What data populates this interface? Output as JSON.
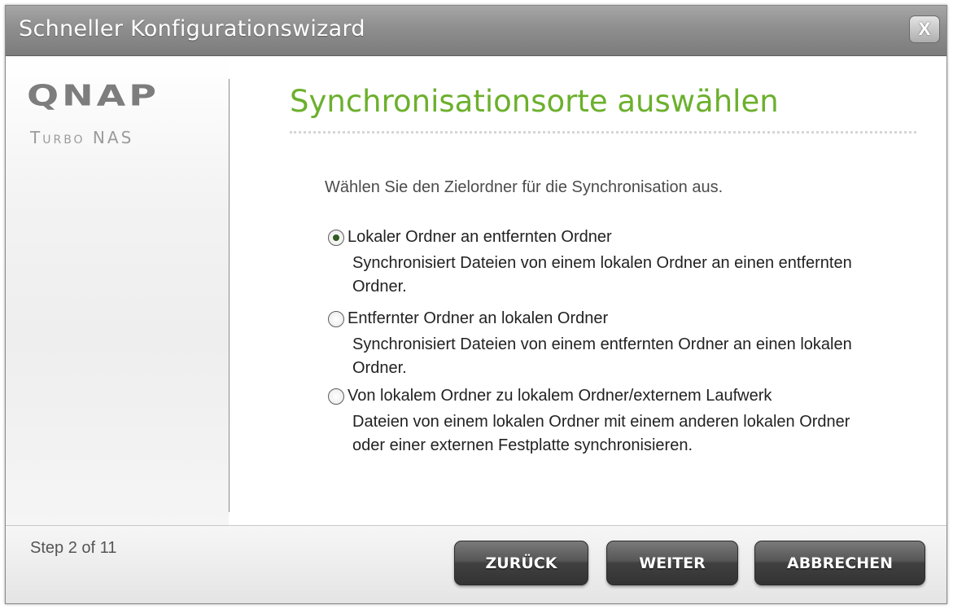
{
  "window": {
    "title": "Schneller Konfigurationswizard",
    "close_label": "X"
  },
  "brand": {
    "logo": "QNAP",
    "sub": "Turbo NAS"
  },
  "main": {
    "heading": "Synchronisationsorte auswählen",
    "intro": "Wählen Sie den Zielordner für die Synchronisation aus.",
    "options": [
      {
        "label": "Lokaler Ordner an entfernten Ordner",
        "description": "Synchronisiert Dateien von einem lokalen Ordner an einen entfernten Ordner.",
        "selected": true
      },
      {
        "label": "Entfernter Ordner an lokalen Ordner",
        "description": "Synchronisiert Dateien von einem entfernten Ordner an einen lokalen Ordner.",
        "selected": false
      },
      {
        "label": "Von lokalem Ordner zu lokalem Ordner/externem Laufwerk",
        "description": "Dateien von einem lokalen Ordner mit einem anderen lokalen Ordner oder einer externen Festplatte synchronisieren.",
        "selected": false
      }
    ]
  },
  "footer": {
    "step": "Step 2 of 11",
    "back_label": "ZURÜCK",
    "next_label": "WEITER",
    "cancel_label": "ABBRECHEN"
  },
  "colors": {
    "heading": "#6cb02d",
    "titlebar": "#8e8e8e",
    "button": "#444444"
  }
}
